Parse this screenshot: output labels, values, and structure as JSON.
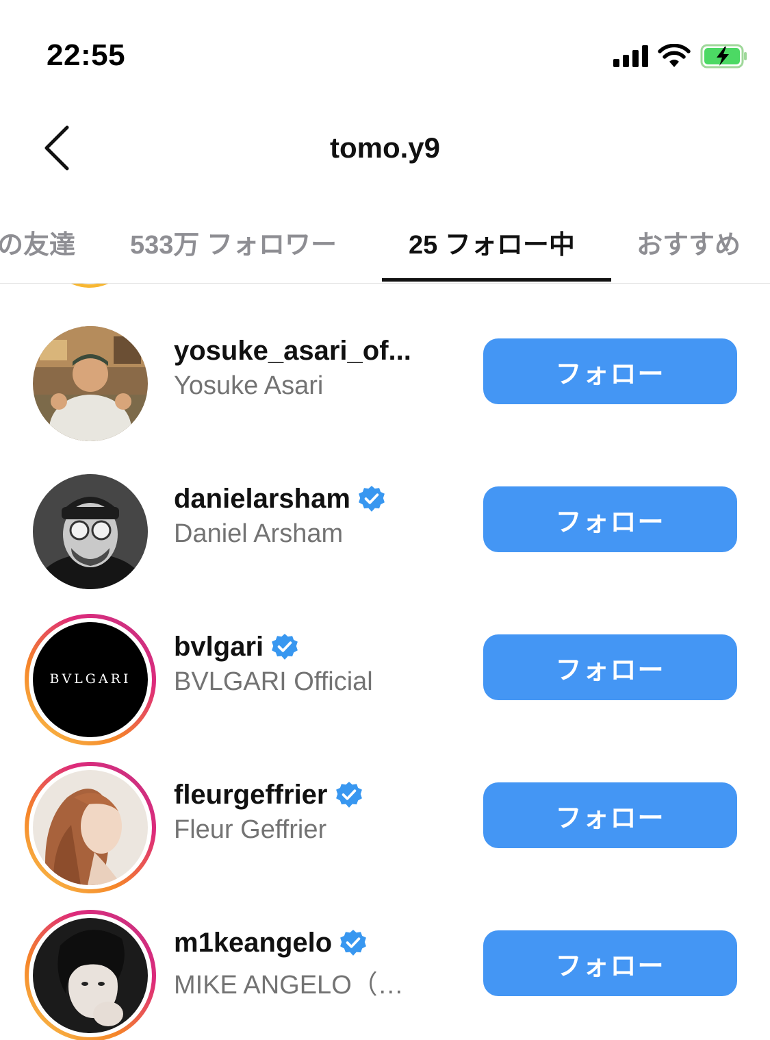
{
  "status_bar": {
    "time": "22:55",
    "icons": [
      "signal-icon",
      "wifi-icon",
      "battery-charging-icon"
    ],
    "battery_color": "#4cd964"
  },
  "header": {
    "title": "tomo.y9",
    "back_icon": "chevron-left-icon"
  },
  "tabs": [
    {
      "label": "の友達",
      "active": false
    },
    {
      "label": "533万 フォロワー",
      "active": false
    },
    {
      "label": "25 フォロー中",
      "active": true
    },
    {
      "label": "おすすめ",
      "active": false
    }
  ],
  "users": [
    {
      "username": "yosuke_asari_of...",
      "full_name": "Yosuke Asari",
      "verified": false,
      "story_ring": false,
      "button": "フォロー"
    },
    {
      "username": "danielarsham",
      "full_name": "Daniel Arsham",
      "verified": true,
      "story_ring": false,
      "button": "フォロー"
    },
    {
      "username": "bvlgari",
      "full_name": "BVLGARI Official",
      "verified": true,
      "story_ring": true,
      "avatar_text": "BVLGARI",
      "button": "フォロー"
    },
    {
      "username": "fleurgeffrier",
      "full_name": "Fleur Geffrier",
      "verified": true,
      "story_ring": true,
      "button": "フォロー"
    },
    {
      "username": "m1keangelo",
      "full_name": "MIKE ANGELO（…",
      "verified": true,
      "story_ring": true,
      "button": "フォロー"
    }
  ],
  "colors": {
    "follow_button": "#4496f4",
    "verified_badge": "#3897f0",
    "secondary_text": "#737373",
    "inactive_tab": "#8e8e93"
  }
}
